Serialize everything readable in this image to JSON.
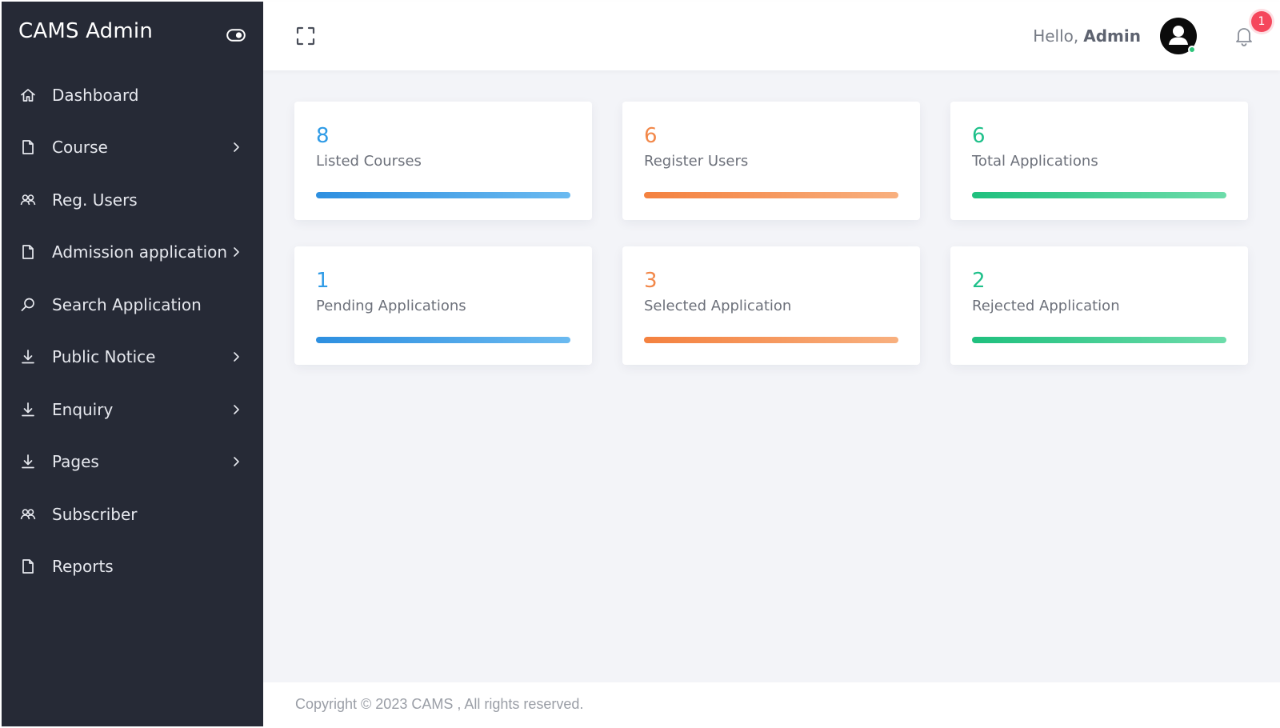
{
  "sidebar": {
    "brand": "CAMS Admin",
    "items": [
      {
        "label": "Dashboard",
        "icon": "home-icon",
        "has_submenu": false
      },
      {
        "label": "Course",
        "icon": "file-icon",
        "has_submenu": true
      },
      {
        "label": "Reg. Users",
        "icon": "users-icon",
        "has_submenu": false
      },
      {
        "label": "Admission application",
        "icon": "file-icon",
        "has_submenu": true
      },
      {
        "label": "Search Application",
        "icon": "search-icon",
        "has_submenu": false
      },
      {
        "label": "Public Notice",
        "icon": "download-icon",
        "has_submenu": true
      },
      {
        "label": "Enquiry",
        "icon": "download-icon",
        "has_submenu": true
      },
      {
        "label": "Pages",
        "icon": "download-icon",
        "has_submenu": true
      },
      {
        "label": "Subscriber",
        "icon": "users-icon",
        "has_submenu": false
      },
      {
        "label": "Reports",
        "icon": "file-icon",
        "has_submenu": false
      }
    ]
  },
  "header": {
    "greeting": "Hello,",
    "user": "Admin",
    "notification_count": "1"
  },
  "cards": [
    {
      "value": "8",
      "label": "Listed Courses",
      "color": "#2f9be6"
    },
    {
      "value": "6",
      "label": "Register Users",
      "color": "#f2884a"
    },
    {
      "value": "6",
      "label": "Total Applications",
      "color": "#1fc08a"
    },
    {
      "value": "1",
      "label": "Pending Applications",
      "color": "#2f9be6"
    },
    {
      "value": "3",
      "label": "Selected Application",
      "color": "#f2884a"
    },
    {
      "value": "2",
      "label": "Rejected Application",
      "color": "#1fc08a"
    }
  ],
  "footer": {
    "text": "Copyright © 2023 CAMS , All rights reserved."
  },
  "colors": {
    "sidebar_bg": "#262a36",
    "main_bg": "#f3f4f8",
    "blue": "#2f9be6",
    "orange": "#f2884a",
    "green": "#1fc08a",
    "badge": "#f5475c"
  }
}
